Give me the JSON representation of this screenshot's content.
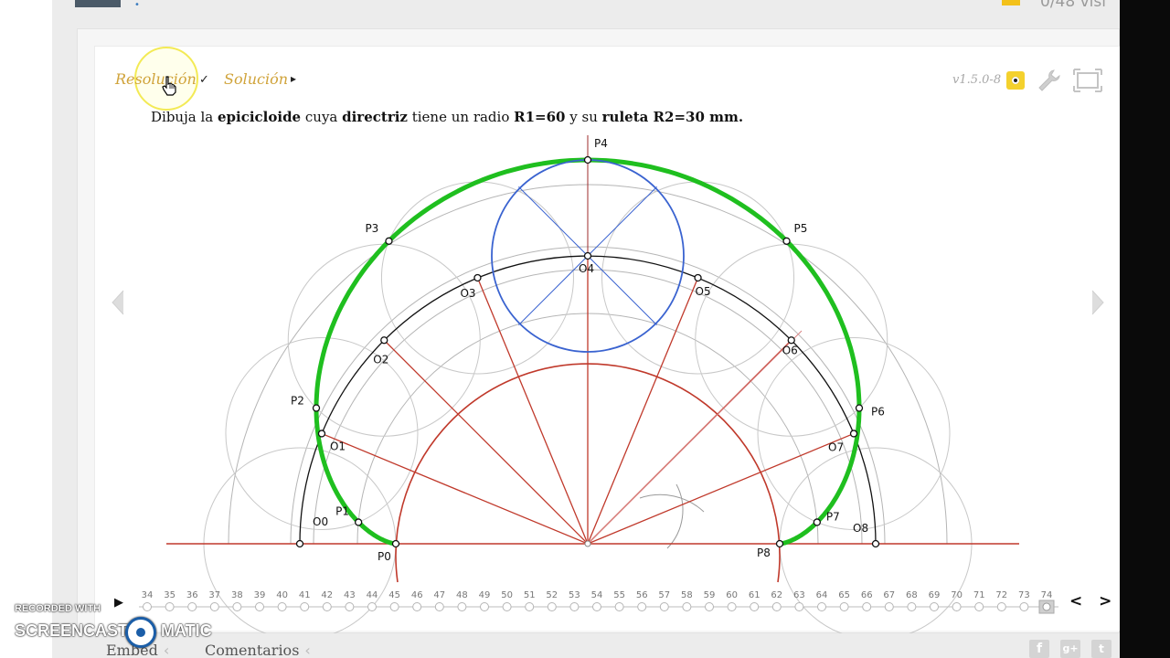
{
  "header": {
    "views_text": "0/48 visi"
  },
  "toolbar": {
    "resolucion_label": "Resolución",
    "resolucion_mark": "✓",
    "solucion_label": "Solución",
    "solucion_arrow": "▸",
    "version": "v1.5.0-8",
    "badge_icon": "eye-badge-icon",
    "settings_icon": "wrench-icon",
    "fullscreen_icon": "fullscreen-icon"
  },
  "statement": {
    "t1": "Dibuja la ",
    "b1": "epicicloide",
    "t2": " cuya ",
    "b2": "directriz",
    "t3": " tiene un radio ",
    "b3": "R1=60",
    "t4": " y su ",
    "b4": "ruleta R2=30 mm."
  },
  "drawing": {
    "point_labels": [
      "P0",
      "P1",
      "P2",
      "P3",
      "P4",
      "P5",
      "P6",
      "P7",
      "P8"
    ],
    "center_labels": [
      "O0",
      "O1",
      "O2",
      "O3",
      "O4",
      "O5",
      "O6",
      "O7",
      "O8"
    ],
    "colors": {
      "epicycloid": "#1fbf1f",
      "directrix": "#c0392b",
      "roulette": "#3a63d0",
      "centers_path": "#111111",
      "construction": "#b5b5b5"
    }
  },
  "timeline": {
    "play_icon": "play-icon",
    "ticks": [
      "34",
      "35",
      "36",
      "37",
      "38",
      "39",
      "40",
      "41",
      "42",
      "43",
      "44",
      "45",
      "46",
      "47",
      "48",
      "49",
      "50",
      "51",
      "52",
      "53",
      "54",
      "55",
      "56",
      "57",
      "58",
      "59",
      "60",
      "61",
      "62",
      "63",
      "64",
      "65",
      "66",
      "67",
      "68",
      "69",
      "70",
      "71",
      "72",
      "73",
      "74"
    ],
    "current": "74",
    "nav": "< >"
  },
  "footer": {
    "embed_label": "Embed",
    "comments_label": "Comentarios",
    "chev": "‹",
    "social": [
      "f",
      "g+",
      "t"
    ]
  },
  "watermark": {
    "line1": "RECORDED WITH",
    "line2": "SCREENCAST",
    "line3": "MATIC"
  }
}
